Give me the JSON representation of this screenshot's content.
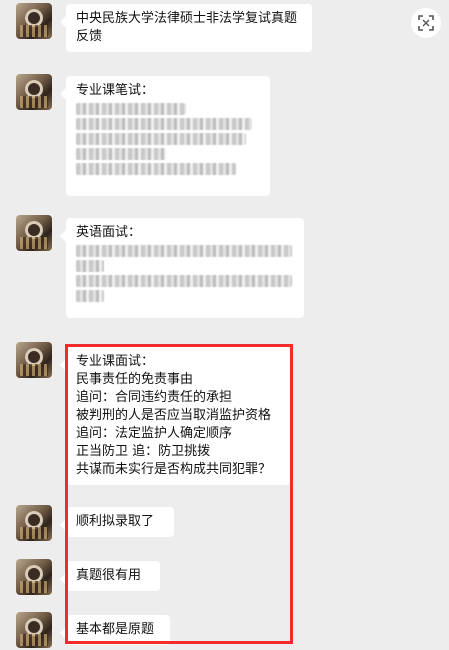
{
  "messages": [
    {
      "text": "中央民族大学法律硕士非法学复试真题反馈"
    },
    {
      "title": "专业课笔试："
    },
    {
      "title": "英语面试："
    },
    {
      "lines": [
        "专业课面试：",
        "民事责任的免责事由",
        "追问：合同违约责任的承担",
        "被判刑的人是否应当取消监护资格",
        "追问：法定监护人确定顺序",
        "正当防卫 追：防卫挑拨",
        "共谋而未实行是否构成共同犯罪？"
      ]
    },
    {
      "text": "顺利拟录取了"
    },
    {
      "text": "真题很有用"
    },
    {
      "text": "基本都是原题"
    }
  ],
  "colors": {
    "background": "#ededed",
    "bubble": "#ffffff",
    "highlight": "#f22c2c"
  },
  "icons": {
    "top_right": "scan-icon"
  }
}
